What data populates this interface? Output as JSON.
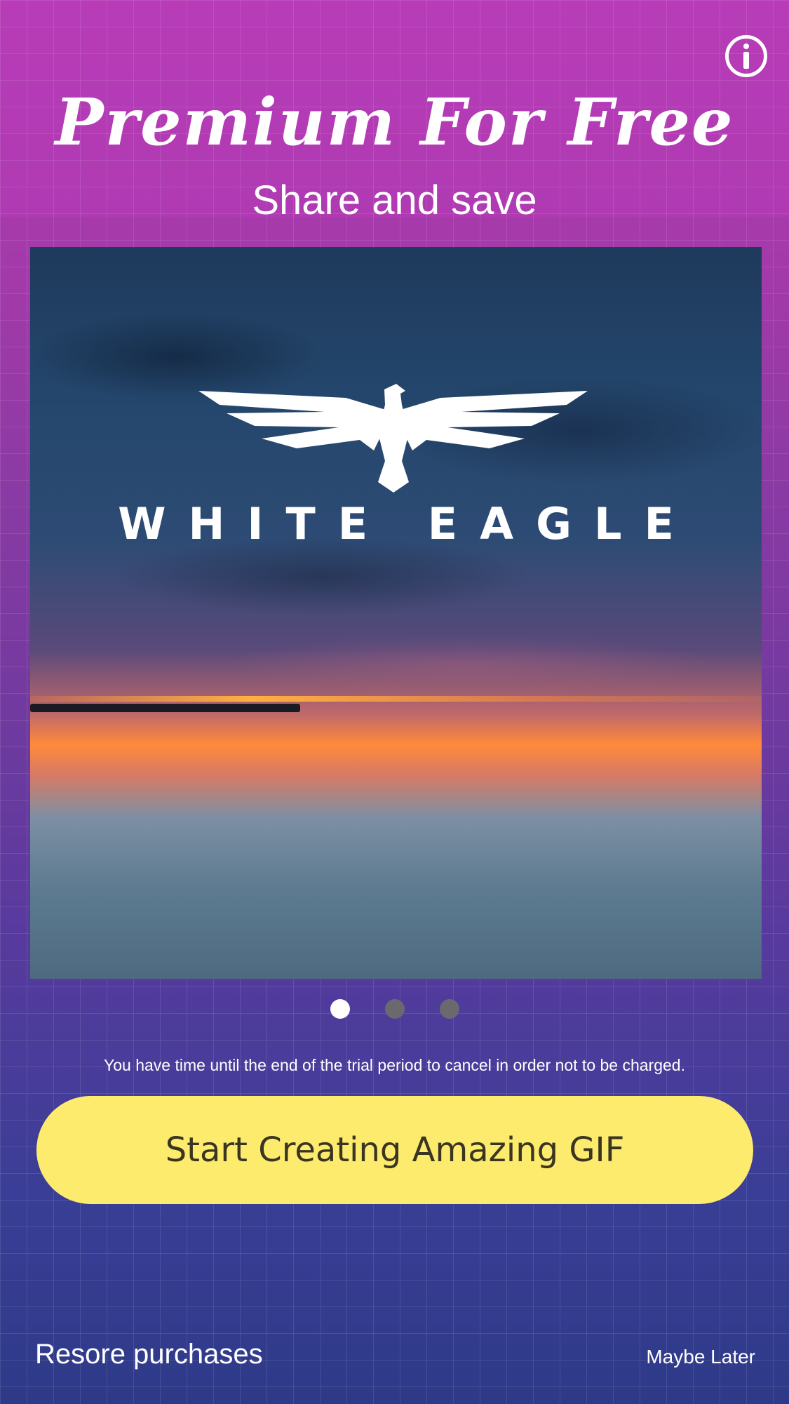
{
  "header": {
    "title": "Premium For Free",
    "subtitle": "Share and save",
    "info_icon": "info-circle-icon"
  },
  "hero": {
    "brand_text": "WHITE EAGLE",
    "logo_icon": "eagle-icon"
  },
  "carousel": {
    "pages": 3,
    "active_index": 0
  },
  "disclaimer": "You have time until the end of the trial period to cancel in order not to be charged.",
  "cta": {
    "label": "Start Creating Amazing GIF",
    "color": "#fdeb6e"
  },
  "footer": {
    "restore_label": "Resore purchases",
    "later_label": "Maybe Later"
  },
  "colors": {
    "bg_top": "#b33cb3",
    "bg_bottom": "#2e3a88"
  }
}
